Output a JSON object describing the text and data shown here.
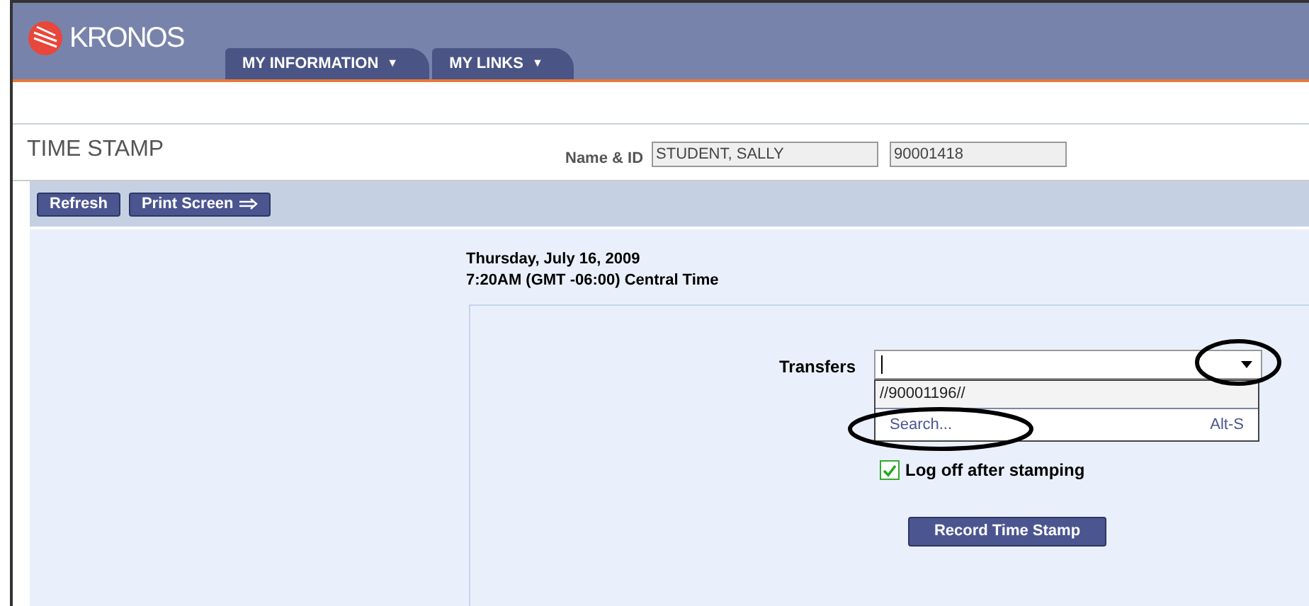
{
  "logo": {
    "text": "KRONOS"
  },
  "tabs": [
    {
      "label": "MY INFORMATION",
      "caret": "▼"
    },
    {
      "label": "MY LINKS",
      "caret": "▼"
    }
  ],
  "page_title": "TIME STAMP",
  "name_id": {
    "label": "Name & ID",
    "name": "STUDENT, SALLY",
    "id": "90001418"
  },
  "toolbar": [
    {
      "label": "Refresh",
      "arrow": false
    },
    {
      "label": "Print Screen",
      "arrow": true
    }
  ],
  "date": "Thursday, July 16, 2009",
  "time": "7:20AM (GMT -06:00) Central Time",
  "transfers": {
    "label": "Transfers",
    "options": [
      {
        "label": "//90001196//",
        "highlighted": true
      },
      {
        "label": "Search...",
        "shortcut": "Alt-S",
        "highlighted": false
      }
    ]
  },
  "logoff": {
    "label": "Log off after stamping",
    "checked": true
  },
  "record_button": "Record Time Stamp"
}
